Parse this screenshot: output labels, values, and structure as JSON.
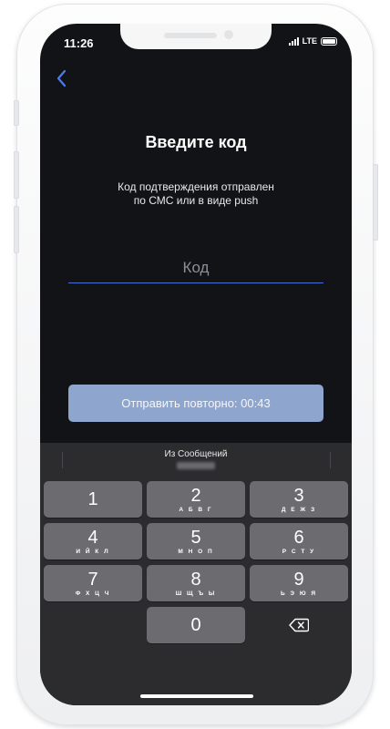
{
  "status_bar": {
    "time": "11:26",
    "network": "LTE"
  },
  "screen": {
    "title": "Введите код",
    "subtitle_line1": "Код подтверждения отправлен",
    "subtitle_line2": "по СМС или в виде push",
    "code_placeholder": "Код",
    "code_value": "",
    "resend_label": "Отправить повторно: 00:43"
  },
  "keyboard": {
    "suggestion_label": "Из Сообщений",
    "keys": [
      {
        "num": "1",
        "letters": ""
      },
      {
        "num": "2",
        "letters": "А Б В Г"
      },
      {
        "num": "3",
        "letters": "Д Е Ж З"
      },
      {
        "num": "4",
        "letters": "И Й К Л"
      },
      {
        "num": "5",
        "letters": "М Н О П"
      },
      {
        "num": "6",
        "letters": "Р С Т У"
      },
      {
        "num": "7",
        "letters": "Ф Х Ц Ч"
      },
      {
        "num": "8",
        "letters": "Ш Щ Ъ Ы"
      },
      {
        "num": "9",
        "letters": "Ь Э Ю Я"
      },
      {
        "num": "0",
        "letters": ""
      }
    ]
  },
  "colors": {
    "background": "#121317",
    "accent": "#4a7df0",
    "resend_button": "#8ea5cd",
    "keyboard": "#2c2c2e",
    "key": "#6b6b70"
  },
  "icons": {
    "back": "chevron-left-icon",
    "delete": "backspace-icon"
  }
}
